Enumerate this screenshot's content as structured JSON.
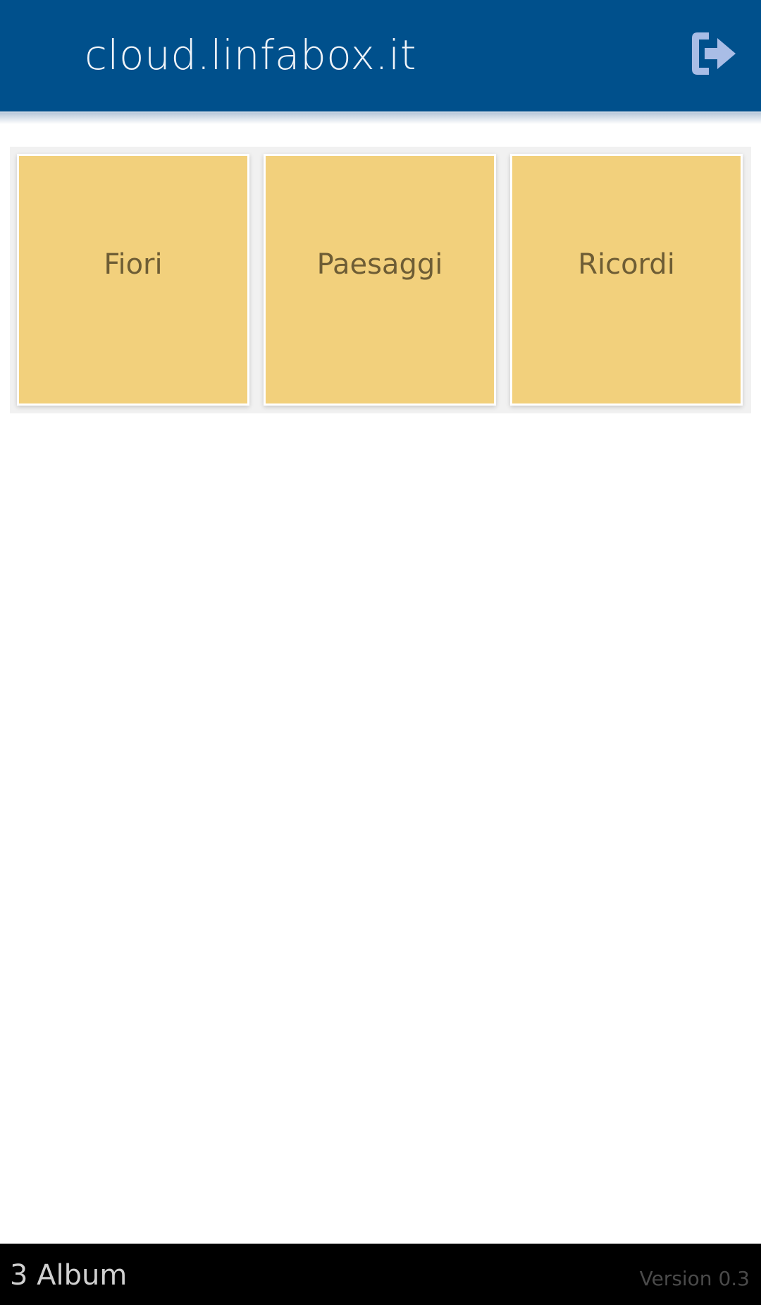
{
  "header": {
    "title": "cloud.linfabox.it",
    "logout_icon": "sign-out-icon",
    "background_color": "#00508c"
  },
  "albums": [
    {
      "label": "Fiori"
    },
    {
      "label": "Paesaggi"
    },
    {
      "label": "Ricordi"
    }
  ],
  "album_tile_color": "#f2d07c",
  "footer": {
    "album_count": "3 Album",
    "version": "Version 0.3"
  }
}
